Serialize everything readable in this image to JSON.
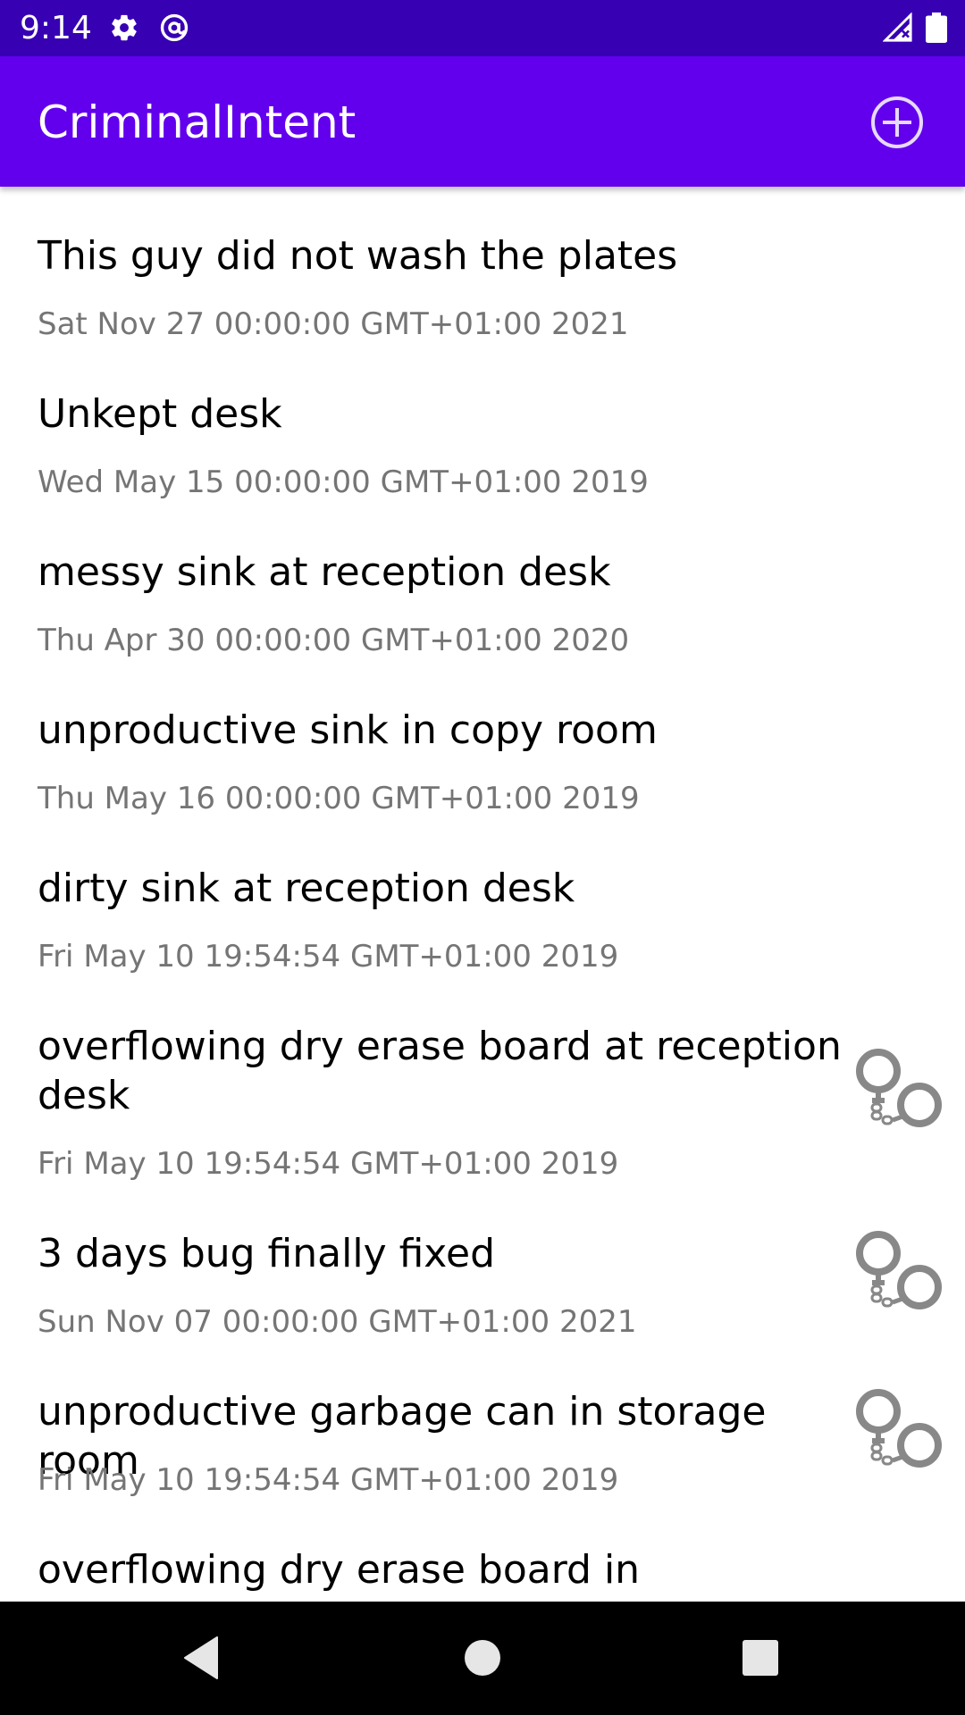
{
  "status_bar": {
    "time": "9:14",
    "icons": [
      "gear-icon",
      "at-sign-icon",
      "signal-icon",
      "battery-icon"
    ]
  },
  "app_bar": {
    "title": "CriminalIntent",
    "add_icon": "add-circle-icon"
  },
  "crimes": [
    {
      "title": "This guy did not wash the plates",
      "date": "Sat Nov 27 00:00:00 GMT+01:00 2021",
      "solved": false
    },
    {
      "title": "Unkept desk",
      "date": "Wed May 15 00:00:00 GMT+01:00 2019",
      "solved": false
    },
    {
      "title": "messy sink at reception desk",
      "date": "Thu Apr 30 00:00:00 GMT+01:00 2020",
      "solved": false
    },
    {
      "title": "unproductive sink in copy room",
      "date": "Thu May 16 00:00:00 GMT+01:00 2019",
      "solved": false
    },
    {
      "title": "dirty sink at reception desk",
      "date": "Fri May 10 19:54:54 GMT+01:00 2019",
      "solved": false
    },
    {
      "title": "overflowing dry erase board at reception desk",
      "date": "Fri May 10 19:54:54 GMT+01:00 2019",
      "solved": true
    },
    {
      "title": "3 days bug finally fixed",
      "date": "Sun Nov 07 00:00:00 GMT+01:00 2021",
      "solved": true
    },
    {
      "title": "unproductive garbage can in storage room",
      "date": "Fri May 10 19:54:54 GMT+01:00 2019",
      "solved": true
    },
    {
      "title": "overflowing dry erase board in bathroom",
      "date": "",
      "solved": false
    }
  ],
  "nav_bar": {
    "buttons": [
      "back-icon",
      "home-icon",
      "recents-icon"
    ]
  },
  "colors": {
    "status_bar": "#3700b3",
    "app_bar": "#6200ee",
    "date_text": "#757575",
    "cuffs_icon": "#888888"
  }
}
